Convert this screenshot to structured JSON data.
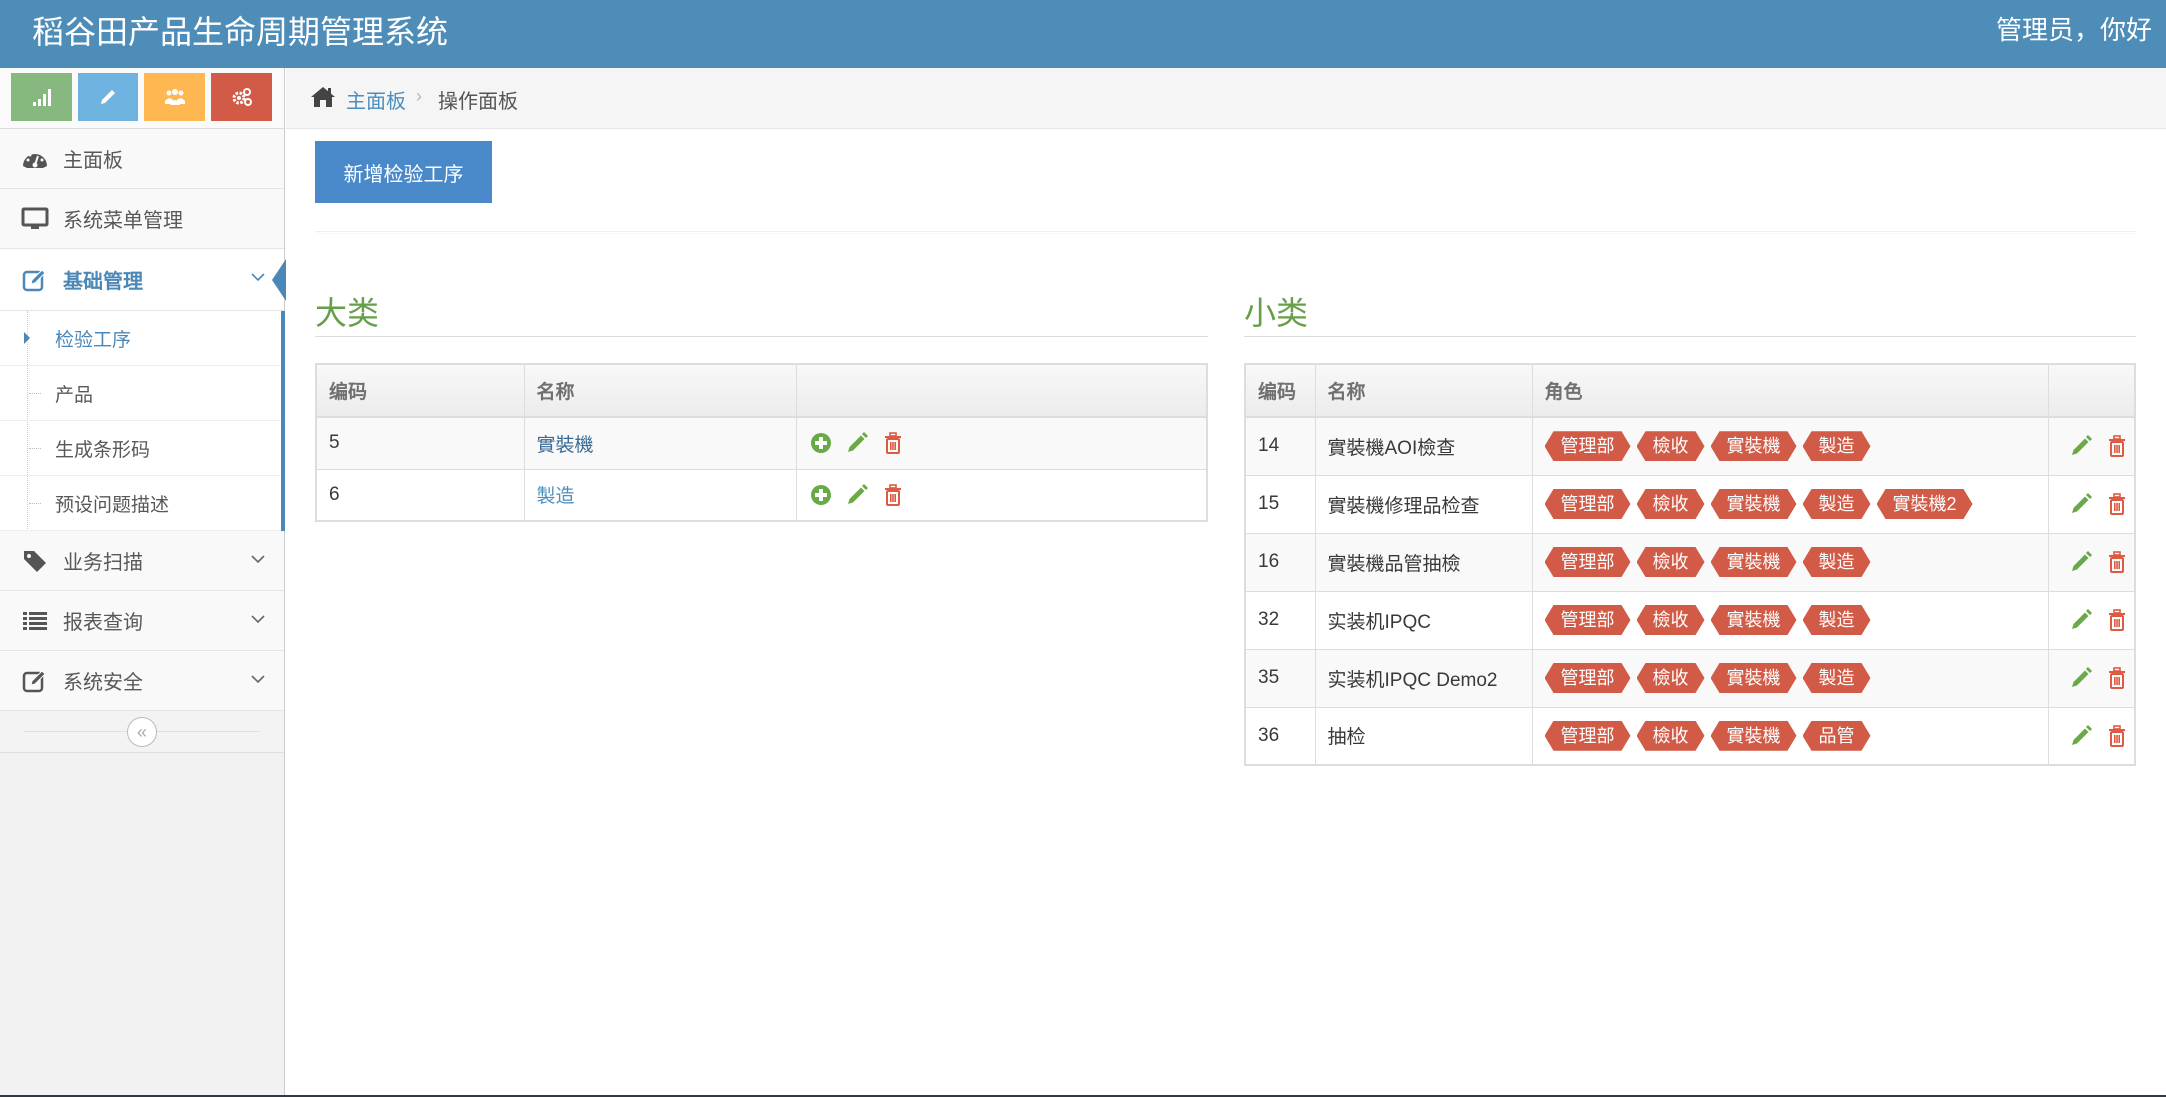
{
  "navbar": {
    "brand": "稻谷田产品生命周期管理系统",
    "user_greeting": "管理员，你好"
  },
  "shortcuts": [
    {
      "icon": "signal-icon",
      "color": "#87b87f"
    },
    {
      "icon": "pencil-icon",
      "color": "#6fb3e0"
    },
    {
      "icon": "users-icon",
      "color": "#ffb752"
    },
    {
      "icon": "cogs-icon",
      "color": "#d15b47"
    }
  ],
  "sidebar": {
    "items": [
      {
        "label": "主面板",
        "icon": "dashboard-icon"
      },
      {
        "label": "系统菜单管理",
        "icon": "desktop-icon"
      },
      {
        "label": "基础管理",
        "icon": "edit-icon",
        "open": true,
        "children": [
          {
            "label": "检验工序",
            "active": true
          },
          {
            "label": "产品"
          },
          {
            "label": "生成条形码"
          },
          {
            "label": "预设问题描述"
          }
        ]
      },
      {
        "label": "业务扫描",
        "icon": "tag-icon"
      },
      {
        "label": "报表查询",
        "icon": "list-icon"
      },
      {
        "label": "系统安全",
        "icon": "edit-icon"
      }
    ],
    "collapse_glyph": "«"
  },
  "breadcrumb": {
    "home": "主面板",
    "separator": "›",
    "current": "操作面板"
  },
  "toolbar": {
    "add_label": "新增检验工序"
  },
  "major": {
    "title": "大类",
    "headers": [
      "编码",
      "名称",
      ""
    ],
    "rows": [
      {
        "code": "5",
        "name": "實裝機"
      },
      {
        "code": "6",
        "name": "製造"
      }
    ]
  },
  "minor": {
    "title": "小类",
    "headers": [
      "编码",
      "名称",
      "角色",
      ""
    ],
    "rows": [
      {
        "code": "14",
        "name": "實裝機AOI檢查",
        "roles": [
          "管理部",
          "檢收",
          "實裝機",
          "製造"
        ]
      },
      {
        "code": "15",
        "name": "實裝機修理品检查",
        "roles": [
          "管理部",
          "檢收",
          "實裝機",
          "製造",
          "實裝機2"
        ]
      },
      {
        "code": "16",
        "name": "實裝機品管抽檢",
        "roles": [
          "管理部",
          "檢收",
          "實裝機",
          "製造"
        ]
      },
      {
        "code": "32",
        "name": "实装机IPQC",
        "roles": [
          "管理部",
          "檢收",
          "實裝機",
          "製造"
        ]
      },
      {
        "code": "35",
        "name": "实装机IPQC Demo2",
        "roles": [
          "管理部",
          "檢收",
          "實裝機",
          "製造"
        ]
      },
      {
        "code": "36",
        "name": "抽检",
        "roles": [
          "管理部",
          "檢收",
          "實裝機",
          "品管"
        ]
      }
    ]
  },
  "colors": {
    "navbar": "#4f8db9",
    "accent": "#4b88b7",
    "section_title": "#669f4a",
    "tag": "#d15b47",
    "action_green": "#69aa46",
    "action_red": "#dd5a43"
  }
}
